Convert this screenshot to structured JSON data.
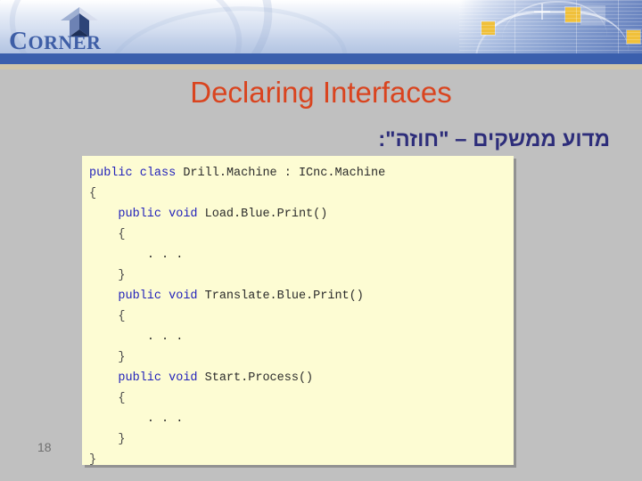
{
  "slide": {
    "title": "Declaring Interfaces",
    "subtitle": "מדוע ממשקים – \"חוזה\":",
    "page_number": "18",
    "title_color": "#d9441f",
    "subtitle_color": "#2d2d7a",
    "background_color": "#c0c0c0",
    "divider_color": "#3a5fad",
    "strip_color": "#cfc6ab"
  },
  "logo": {
    "wordmark_initial": "C",
    "wordmark_rest": "ORNER",
    "color": "#3e5ea6"
  },
  "code": {
    "background_color": "#fdfcd3",
    "keyword_color": "#2222bb",
    "identifier_color": "#2b2b2b",
    "lines": [
      {
        "indent": 0,
        "tokens": [
          {
            "t": "public",
            "c": "kw"
          },
          {
            "t": " ",
            "c": "id"
          },
          {
            "t": "class",
            "c": "kw"
          },
          {
            "t": " Drill.Machine : ICnc.Machine",
            "c": "id"
          }
        ]
      },
      {
        "indent": 0,
        "tokens": [
          {
            "t": "{",
            "c": "br"
          }
        ]
      },
      {
        "indent": 1,
        "tokens": [
          {
            "t": "public",
            "c": "kw"
          },
          {
            "t": " ",
            "c": "id"
          },
          {
            "t": "void",
            "c": "kw"
          },
          {
            "t": " Load.Blue.Print()",
            "c": "id"
          }
        ]
      },
      {
        "indent": 1,
        "tokens": [
          {
            "t": "{",
            "c": "br"
          }
        ]
      },
      {
        "indent": 2,
        "tokens": [
          {
            "t": ". . .",
            "c": "id"
          }
        ]
      },
      {
        "indent": 1,
        "tokens": [
          {
            "t": "}",
            "c": "br"
          }
        ]
      },
      {
        "indent": 1,
        "tokens": [
          {
            "t": "public",
            "c": "kw"
          },
          {
            "t": " ",
            "c": "id"
          },
          {
            "t": "void",
            "c": "kw"
          },
          {
            "t": " Translate.Blue.Print()",
            "c": "id"
          }
        ]
      },
      {
        "indent": 1,
        "tokens": [
          {
            "t": "{",
            "c": "br"
          }
        ]
      },
      {
        "indent": 2,
        "tokens": [
          {
            "t": ". . .",
            "c": "id"
          }
        ]
      },
      {
        "indent": 1,
        "tokens": [
          {
            "t": "}",
            "c": "br"
          }
        ]
      },
      {
        "indent": 1,
        "tokens": [
          {
            "t": "public",
            "c": "kw"
          },
          {
            "t": " ",
            "c": "id"
          },
          {
            "t": "void",
            "c": "kw"
          },
          {
            "t": " Start.Process()",
            "c": "id"
          }
        ]
      },
      {
        "indent": 1,
        "tokens": [
          {
            "t": "{",
            "c": "br"
          }
        ]
      },
      {
        "indent": 2,
        "tokens": [
          {
            "t": ". . .",
            "c": "id"
          }
        ]
      },
      {
        "indent": 1,
        "tokens": [
          {
            "t": "}",
            "c": "br"
          }
        ]
      },
      {
        "indent": 0,
        "tokens": [
          {
            "t": "}",
            "c": "br"
          }
        ]
      }
    ]
  },
  "header_graphic": {
    "accent_square_color": "#f0c03a"
  }
}
